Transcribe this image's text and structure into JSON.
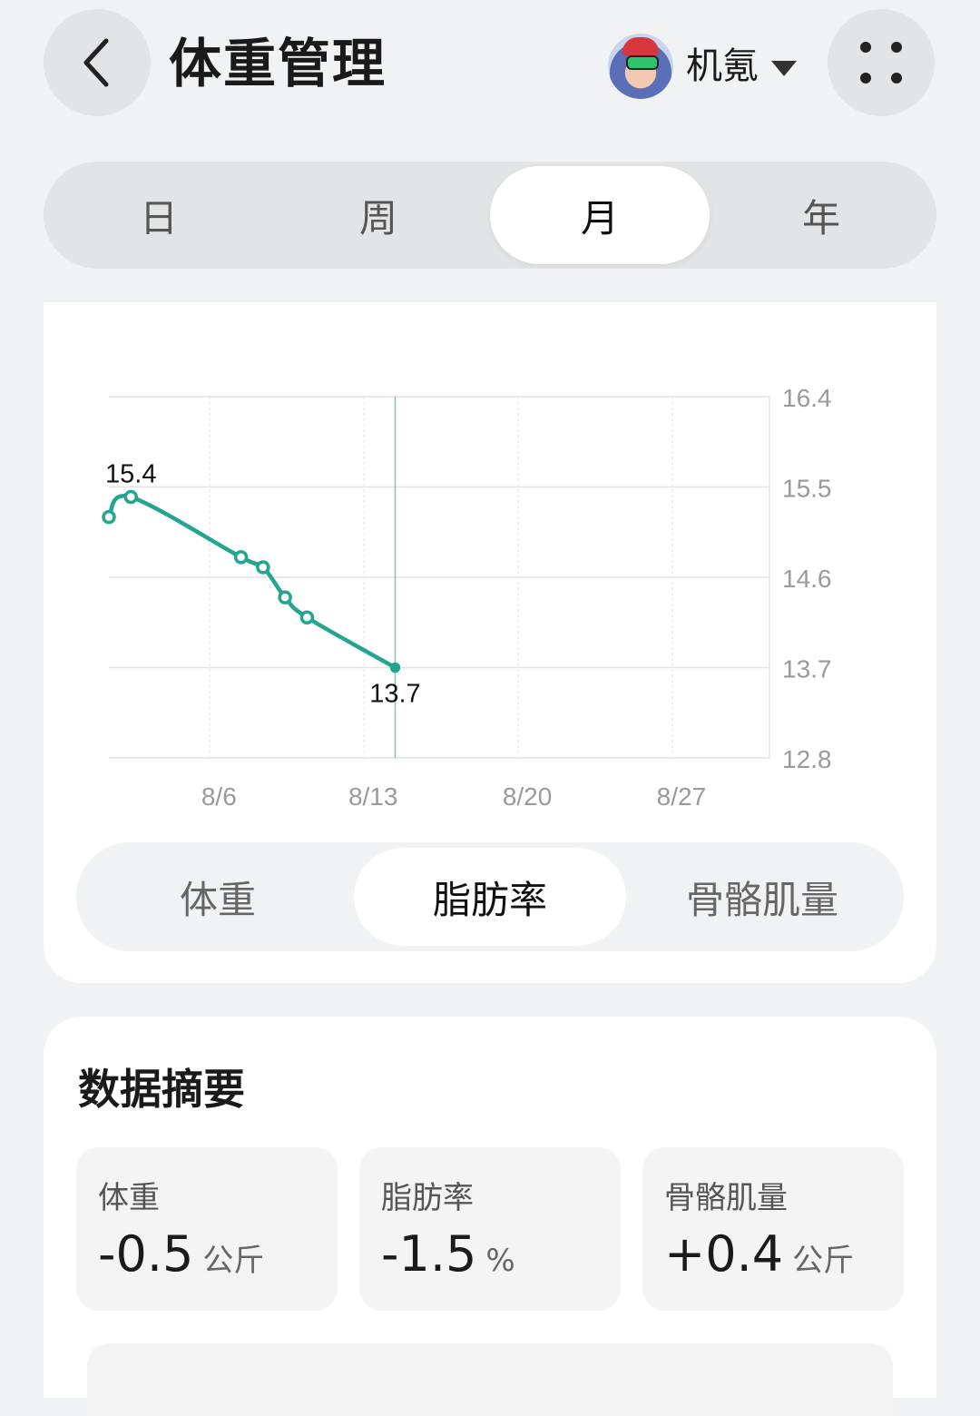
{
  "header": {
    "title": "体重管理",
    "user_name": "机氪"
  },
  "period_tabs": [
    {
      "label": "日",
      "active": false
    },
    {
      "label": "周",
      "active": false
    },
    {
      "label": "月",
      "active": true
    },
    {
      "label": "年",
      "active": false
    }
  ],
  "metric_tabs": [
    {
      "label": "体重",
      "active": false
    },
    {
      "label": "脂肪率",
      "active": true
    },
    {
      "label": "骨骼肌量",
      "active": false
    }
  ],
  "chart_data": {
    "type": "line",
    "x_tick_labels": [
      "8/6",
      "8/13",
      "8/20",
      "8/27"
    ],
    "y_tick_labels": [
      "16.4",
      "15.5",
      "14.6",
      "13.7",
      "12.8"
    ],
    "ylim": [
      12.8,
      16.4
    ],
    "grid": true,
    "series": [
      {
        "x": [
          "8/1",
          "8/2",
          "8/7",
          "8/8",
          "8/9",
          "8/10",
          "8/14"
        ],
        "values": [
          15.2,
          15.4,
          14.8,
          14.7,
          14.4,
          14.2,
          13.7
        ]
      }
    ],
    "data_labels": [
      {
        "x": "8/2",
        "text": "15.4"
      },
      {
        "x": "8/14",
        "text": "13.7"
      }
    ],
    "marker_line_x": "8/14",
    "line_color": "#23a58f"
  },
  "summary": {
    "title": "数据摘要",
    "items": [
      {
        "label": "体重",
        "value": "-0.5",
        "unit": "公斤"
      },
      {
        "label": "脂肪率",
        "value": "-1.5",
        "unit": "%"
      },
      {
        "label": "骨骼肌量",
        "value": "+0.4",
        "unit": "公斤"
      }
    ]
  }
}
